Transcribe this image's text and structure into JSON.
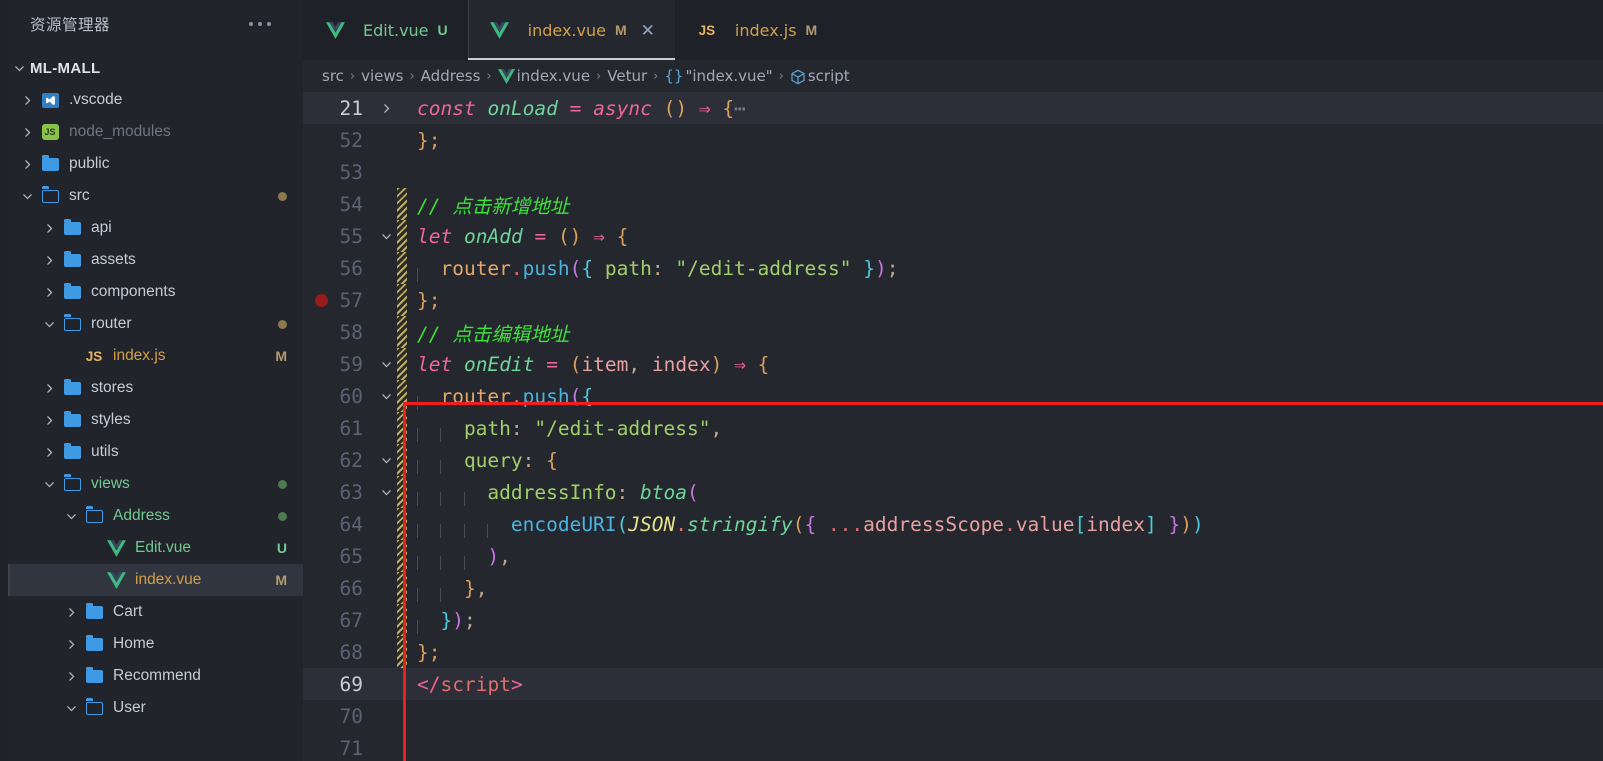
{
  "sidebar": {
    "title": "资源管理器",
    "more_icon": "ellipsis-icon",
    "root": {
      "label": "ML-MALL",
      "expanded": true
    },
    "items": [
      {
        "label": ".vscode",
        "icon": "vscode-folder-icon",
        "indent": 1,
        "twisty": "chevron-right",
        "badge": "",
        "state": "normal"
      },
      {
        "label": "node_modules",
        "icon": "node-folder-icon",
        "indent": 1,
        "twisty": "chevron-right",
        "badge": "",
        "state": "dim"
      },
      {
        "label": "public",
        "icon": "folder-icon",
        "indent": 1,
        "twisty": "chevron-right",
        "badge": "",
        "state": "normal"
      },
      {
        "label": "src",
        "icon": "folder-open-icon",
        "indent": 1,
        "twisty": "chevron-down",
        "badge": "",
        "state": "normal",
        "dot": "#8a7a4e"
      },
      {
        "label": "api",
        "icon": "folder-icon",
        "indent": 2,
        "twisty": "chevron-right",
        "badge": "",
        "state": "normal"
      },
      {
        "label": "assets",
        "icon": "folder-icon",
        "indent": 2,
        "twisty": "chevron-right",
        "badge": "",
        "state": "normal"
      },
      {
        "label": "components",
        "icon": "folder-icon",
        "indent": 2,
        "twisty": "chevron-right",
        "badge": "",
        "state": "normal"
      },
      {
        "label": "router",
        "icon": "folder-open-icon",
        "indent": 2,
        "twisty": "chevron-down",
        "badge": "",
        "state": "normal",
        "dot": "#8a7a4e"
      },
      {
        "label": "index.js",
        "icon": "js-icon",
        "indent": 3,
        "twisty": "none",
        "badge": "M",
        "state": "mod"
      },
      {
        "label": "stores",
        "icon": "folder-icon",
        "indent": 2,
        "twisty": "chevron-right",
        "badge": "",
        "state": "normal"
      },
      {
        "label": "styles",
        "icon": "folder-icon",
        "indent": 2,
        "twisty": "chevron-right",
        "badge": "",
        "state": "normal"
      },
      {
        "label": "utils",
        "icon": "folder-icon",
        "indent": 2,
        "twisty": "chevron-right",
        "badge": "",
        "state": "normal"
      },
      {
        "label": "views",
        "icon": "folder-open-icon",
        "indent": 2,
        "twisty": "chevron-down",
        "badge": "",
        "state": "untracked",
        "dot": "#4e7a4e"
      },
      {
        "label": "Address",
        "icon": "folder-open-icon",
        "indent": 3,
        "twisty": "chevron-down",
        "badge": "",
        "state": "untracked",
        "dot": "#4e7a4e"
      },
      {
        "label": "Edit.vue",
        "icon": "vue-icon",
        "indent": 4,
        "twisty": "none",
        "badge": "U",
        "state": "untracked"
      },
      {
        "label": "index.vue",
        "icon": "vue-icon",
        "indent": 4,
        "twisty": "none",
        "badge": "M",
        "state": "mod",
        "selected": true
      },
      {
        "label": "Cart",
        "icon": "folder-icon",
        "indent": 3,
        "twisty": "chevron-right",
        "badge": "",
        "state": "normal"
      },
      {
        "label": "Home",
        "icon": "folder-icon",
        "indent": 3,
        "twisty": "chevron-right",
        "badge": "",
        "state": "normal"
      },
      {
        "label": "Recommend",
        "icon": "folder-icon",
        "indent": 3,
        "twisty": "chevron-right",
        "badge": "",
        "state": "normal"
      },
      {
        "label": "User",
        "icon": "folder-open-icon",
        "indent": 3,
        "twisty": "chevron-down",
        "badge": "",
        "state": "normal"
      }
    ]
  },
  "tabs": [
    {
      "label": "Edit.vue",
      "icon": "vue-icon",
      "badge": "U",
      "state": "untracked",
      "active": false,
      "closable": false
    },
    {
      "label": "index.vue",
      "icon": "vue-icon",
      "badge": "M",
      "state": "mod",
      "active": true,
      "closable": true,
      "close_icon": "close-icon"
    },
    {
      "label": "index.js",
      "icon": "js-icon",
      "badge": "M",
      "state": "mod",
      "active": false,
      "closable": false
    }
  ],
  "breadcrumb": [
    {
      "label": "src",
      "icon": "none"
    },
    {
      "label": "views",
      "icon": "none"
    },
    {
      "label": "Address",
      "icon": "none"
    },
    {
      "label": "index.vue",
      "icon": "vue-icon"
    },
    {
      "label": "Vetur",
      "icon": "none"
    },
    {
      "label": "\"index.vue\"",
      "icon": "braces-icon"
    },
    {
      "label": "script",
      "icon": "cube-icon"
    }
  ],
  "editor": {
    "current_line": 69,
    "breakpoint_line": 57,
    "lines": [
      {
        "n": 21,
        "fold": "chevron-right",
        "git": false,
        "current": true,
        "tokens": [
          {
            "t": "const",
            "c": "t-kw"
          },
          {
            "t": " ",
            "c": ""
          },
          {
            "t": "onLoad",
            "c": "t-fn"
          },
          {
            "t": " ",
            "c": ""
          },
          {
            "t": "=",
            "c": "t-op"
          },
          {
            "t": " ",
            "c": ""
          },
          {
            "t": "async",
            "c": "t-kw"
          },
          {
            "t": " ",
            "c": ""
          },
          {
            "t": "()",
            "c": "t-paren"
          },
          {
            "t": " ",
            "c": ""
          },
          {
            "t": "⇒",
            "c": "t-arrow"
          },
          {
            "t": " ",
            "c": ""
          },
          {
            "t": "{",
            "c": "t-brace"
          },
          {
            "t": "⋯",
            "c": "t-ellip"
          }
        ]
      },
      {
        "n": 52,
        "fold": "none",
        "git": false,
        "current": false,
        "tokens": [
          {
            "t": "};",
            "c": "t-brace"
          }
        ]
      },
      {
        "n": 53,
        "fold": "none",
        "git": false,
        "current": false,
        "tokens": []
      },
      {
        "n": 54,
        "fold": "none",
        "git": true,
        "current": false,
        "tokens": [
          {
            "t": "// 点击新增地址",
            "c": "t-comment"
          }
        ]
      },
      {
        "n": 55,
        "fold": "chevron-down",
        "git": true,
        "current": false,
        "tokens": [
          {
            "t": "let",
            "c": "t-kw"
          },
          {
            "t": " ",
            "c": ""
          },
          {
            "t": "onAdd",
            "c": "t-fn"
          },
          {
            "t": " ",
            "c": ""
          },
          {
            "t": "=",
            "c": "t-op"
          },
          {
            "t": " ",
            "c": ""
          },
          {
            "t": "()",
            "c": "t-paren"
          },
          {
            "t": " ",
            "c": ""
          },
          {
            "t": "⇒",
            "c": "t-arrow"
          },
          {
            "t": " ",
            "c": ""
          },
          {
            "t": "{",
            "c": "t-brace"
          }
        ]
      },
      {
        "n": 56,
        "fold": "none",
        "git": true,
        "current": false,
        "indent": 1,
        "tokens": [
          {
            "t": "router",
            "c": "t-var"
          },
          {
            "t": ".",
            "c": "t-dot"
          },
          {
            "t": "push",
            "c": "t-method"
          },
          {
            "t": "(",
            "c": "t-paren2"
          },
          {
            "t": "{",
            "c": "t-brace2"
          },
          {
            "t": " ",
            "c": ""
          },
          {
            "t": "path",
            "c": "t-prop"
          },
          {
            "t": ":",
            "c": "t-punct"
          },
          {
            "t": " ",
            "c": ""
          },
          {
            "t": "\"/edit-address\"",
            "c": "t-str"
          },
          {
            "t": " ",
            "c": ""
          },
          {
            "t": "}",
            "c": "t-brace2"
          },
          {
            "t": ")",
            "c": "t-paren2"
          },
          {
            "t": ";",
            "c": "t-punct"
          }
        ]
      },
      {
        "n": 57,
        "fold": "none",
        "git": true,
        "current": false,
        "tokens": [
          {
            "t": "};",
            "c": "t-brace"
          }
        ]
      },
      {
        "n": 58,
        "fold": "none",
        "git": true,
        "current": false,
        "tokens": [
          {
            "t": "// 点击编辑地址",
            "c": "t-comment"
          }
        ]
      },
      {
        "n": 59,
        "fold": "chevron-down",
        "git": true,
        "current": false,
        "tokens": [
          {
            "t": "let",
            "c": "t-kw"
          },
          {
            "t": " ",
            "c": ""
          },
          {
            "t": "onEdit",
            "c": "t-fn"
          },
          {
            "t": " ",
            "c": ""
          },
          {
            "t": "=",
            "c": "t-op"
          },
          {
            "t": " ",
            "c": ""
          },
          {
            "t": "(",
            "c": "t-paren"
          },
          {
            "t": "item",
            "c": "t-param"
          },
          {
            "t": ",",
            "c": "t-punct"
          },
          {
            "t": " ",
            "c": ""
          },
          {
            "t": "index",
            "c": "t-param"
          },
          {
            "t": ")",
            "c": "t-paren"
          },
          {
            "t": " ",
            "c": ""
          },
          {
            "t": "⇒",
            "c": "t-arrow"
          },
          {
            "t": " ",
            "c": ""
          },
          {
            "t": "{",
            "c": "t-brace"
          }
        ]
      },
      {
        "n": 60,
        "fold": "chevron-down",
        "git": true,
        "current": false,
        "indent": 1,
        "tokens": [
          {
            "t": "router",
            "c": "t-var"
          },
          {
            "t": ".",
            "c": "t-dot"
          },
          {
            "t": "push",
            "c": "t-method"
          },
          {
            "t": "(",
            "c": "t-paren2"
          },
          {
            "t": "{",
            "c": "t-brace2"
          }
        ]
      },
      {
        "n": 61,
        "fold": "none",
        "git": true,
        "current": false,
        "indent": 2,
        "tokens": [
          {
            "t": "path",
            "c": "t-prop"
          },
          {
            "t": ":",
            "c": "t-punct"
          },
          {
            "t": " ",
            "c": ""
          },
          {
            "t": "\"/edit-address\"",
            "c": "t-str"
          },
          {
            "t": ",",
            "c": "t-punct"
          }
        ]
      },
      {
        "n": 62,
        "fold": "chevron-down",
        "git": true,
        "current": false,
        "indent": 2,
        "tokens": [
          {
            "t": "query",
            "c": "t-prop"
          },
          {
            "t": ":",
            "c": "t-punct"
          },
          {
            "t": " ",
            "c": ""
          },
          {
            "t": "{",
            "c": "t-brace"
          }
        ]
      },
      {
        "n": 63,
        "fold": "chevron-down",
        "git": true,
        "current": false,
        "indent": 3,
        "tokens": [
          {
            "t": "addressInfo",
            "c": "t-prop"
          },
          {
            "t": ":",
            "c": "t-punct"
          },
          {
            "t": " ",
            "c": ""
          },
          {
            "t": "btoa",
            "c": "t-fn"
          },
          {
            "t": "(",
            "c": "t-paren2"
          }
        ]
      },
      {
        "n": 64,
        "fold": "none",
        "git": true,
        "current": false,
        "indent": 4,
        "tokens": [
          {
            "t": "encodeURI",
            "c": "t-method"
          },
          {
            "t": "(",
            "c": "t-paren3"
          },
          {
            "t": "JSON",
            "c": "t-class"
          },
          {
            "t": ".",
            "c": "t-dot"
          },
          {
            "t": "stringify",
            "c": "t-fn"
          },
          {
            "t": "(",
            "c": "t-paren"
          },
          {
            "t": "{",
            "c": "t-brace3"
          },
          {
            "t": " ",
            "c": ""
          },
          {
            "t": "...",
            "c": "t-spread"
          },
          {
            "t": "addressScope",
            "c": "t-param"
          },
          {
            "t": ".",
            "c": "t-dot"
          },
          {
            "t": "value",
            "c": "t-param"
          },
          {
            "t": "[",
            "c": "t-idx"
          },
          {
            "t": "index",
            "c": "t-param"
          },
          {
            "t": "]",
            "c": "t-idx"
          },
          {
            "t": " ",
            "c": ""
          },
          {
            "t": "}",
            "c": "t-brace3"
          },
          {
            "t": ")",
            "c": "t-paren"
          },
          {
            "t": ")",
            "c": "t-paren3"
          }
        ]
      },
      {
        "n": 65,
        "fold": "none",
        "git": true,
        "current": false,
        "indent": 3,
        "tokens": [
          {
            "t": ")",
            "c": "t-paren2"
          },
          {
            "t": ",",
            "c": "t-punct"
          }
        ]
      },
      {
        "n": 66,
        "fold": "none",
        "git": true,
        "current": false,
        "indent": 2,
        "tokens": [
          {
            "t": "}",
            "c": "t-brace"
          },
          {
            "t": ",",
            "c": "t-punct"
          }
        ]
      },
      {
        "n": 67,
        "fold": "none",
        "git": true,
        "current": false,
        "indent": 1,
        "tokens": [
          {
            "t": "}",
            "c": "t-brace2"
          },
          {
            "t": ")",
            "c": "t-paren2"
          },
          {
            "t": ";",
            "c": "t-punct"
          }
        ]
      },
      {
        "n": 68,
        "fold": "none",
        "git": true,
        "current": false,
        "tokens": [
          {
            "t": "};",
            "c": "t-brace"
          }
        ]
      },
      {
        "n": 69,
        "fold": "none",
        "git": false,
        "current": true,
        "tokens": [
          {
            "t": "</",
            "c": "t-tag"
          },
          {
            "t": "script",
            "c": "t-tagname"
          },
          {
            "t": ">",
            "c": "t-tag"
          }
        ]
      },
      {
        "n": 70,
        "fold": "none",
        "git": false,
        "current": false,
        "tokens": []
      },
      {
        "n": 71,
        "fold": "none",
        "git": false,
        "current": false,
        "tokens": []
      }
    ]
  },
  "annotation": {
    "color": "#f01f1f",
    "shape": "rectangle"
  }
}
